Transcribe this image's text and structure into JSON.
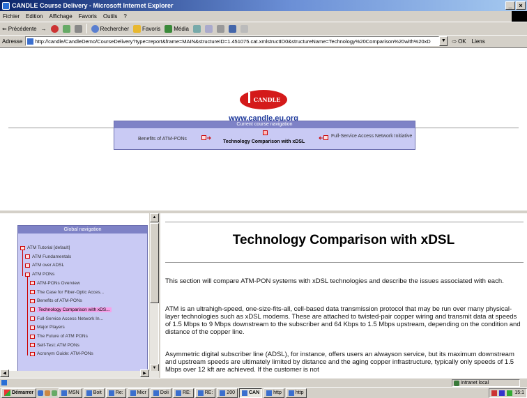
{
  "window": {
    "title": "CANDLE Course Delivery - Microsoft Internet Explorer",
    "buttons": [
      "_",
      "×"
    ]
  },
  "menu": [
    "Fichier",
    "Edition",
    "Affichage",
    "Favoris",
    "Outils",
    "?"
  ],
  "toolbar": {
    "back": "Précédente",
    "forward": "→",
    "search": "Rechercher",
    "favorites": "Favoris",
    "media": "Média"
  },
  "address": {
    "label": "Adresse",
    "url": "http://candle/CandleDemo/CourseDelivery?type=report&frame=MAIN&structureID=1.451075.cat.xmlstructID0&structureName=Technology%20Comparison%20with%20xD",
    "go": "OK",
    "links": "Liens"
  },
  "header": {
    "logo_text": "CANDLE",
    "site_url": "www.candle.eu.org"
  },
  "course_nav": {
    "heading": "Current course navigation",
    "previous": "Benefits of ATM-PONs",
    "current": "Technology Comparison with xDSL",
    "next": "Full-Service Access Network Initiative"
  },
  "global_nav": {
    "heading": "Global navigation",
    "items": [
      {
        "label": "ATM Tutorial [default]",
        "level": 0
      },
      {
        "label": "ATM Fundamentals",
        "level": 1
      },
      {
        "label": "ATM over ADSL",
        "level": 1
      },
      {
        "label": "ATM PONs",
        "level": 1
      },
      {
        "label": "ATM-PONs Overview",
        "level": 2
      },
      {
        "label": "The Case for Fiber-Optic Acces...",
        "level": 2
      },
      {
        "label": "Benefits of ATM-PONs",
        "level": 2
      },
      {
        "label": "Technology Comparison with xDS...",
        "level": 2,
        "selected": true
      },
      {
        "label": "Full-Service Access Network In...",
        "level": 2
      },
      {
        "label": "Major Players",
        "level": 2
      },
      {
        "label": "The Future of ATM PONs",
        "level": 2
      },
      {
        "label": "Self-Test: ATM PONs",
        "level": 2
      },
      {
        "label": "Acronym Guide: ATM-PONs",
        "level": 2
      }
    ]
  },
  "main": {
    "title": "Technology Comparison with xDSL",
    "paragraphs": [
      "This section will compare ATM-PON systems with xDSL technologies and describe the issues associated with each.",
      "ATM is an ultrahigh-speed, one-size-fits-all, cell-based data transmission protocol that may be run over many physical-layer technologies such as xDSL modems. These are attached to twisted-pair copper wiring and transmit data at speeds of 1.5 Mbps to 9 Mbps downstream to the subscriber and 64 Kbps to 1.5 Mbps upstream, depending on the condition and distance of the copper line.",
      "Asymmetric digital subscriber line (ADSL), for instance, offers users an alwayson service, but its maximum downstream and upstream speeds are ultimately limited by distance and the aging copper infrastructure, typically only speeds of 1.5 Mbps over 12 kft are achieved. If the customer is not"
    ]
  },
  "status": {
    "zone": "Intranet local"
  },
  "taskbar": {
    "start": "Démarrer",
    "buttons": [
      "MSN",
      "Boit",
      "Re:",
      "Micr",
      "Doli",
      "RE:",
      "RE:",
      "200",
      "CAN",
      "http",
      "http"
    ],
    "active_index": 8,
    "clock": "15:1"
  }
}
